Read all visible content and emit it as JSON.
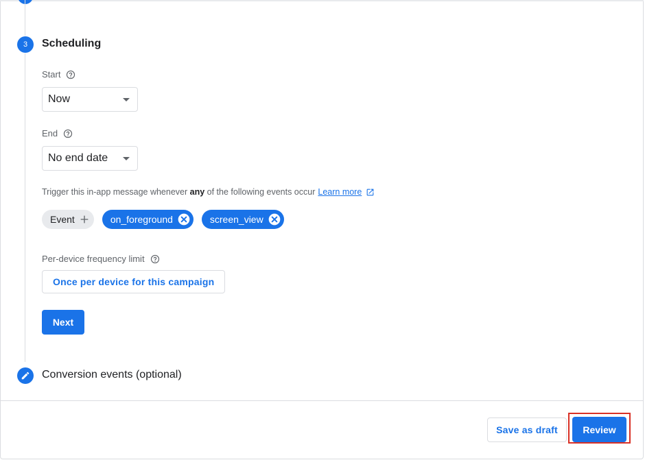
{
  "step3": {
    "number": "3",
    "title": "Scheduling"
  },
  "start": {
    "label": "Start",
    "value": "Now"
  },
  "end": {
    "label": "End",
    "value": "No end date"
  },
  "trigger": {
    "text_before": "Trigger this in-app message whenever ",
    "text_bold": "any",
    "text_after": " of the following events occur",
    "link": "Learn more"
  },
  "events": {
    "add_label": "Event",
    "chips": [
      "on_foreground",
      "screen_view"
    ]
  },
  "frequency": {
    "label": "Per-device frequency limit",
    "value": "Once per device for this campaign"
  },
  "next_label": "Next",
  "step4": {
    "title": "Conversion events (optional)"
  },
  "footer": {
    "draft_label": "Save as draft",
    "review_label": "Review"
  },
  "colors": {
    "primary": "#1a73e8",
    "highlight": "#d93025",
    "chip_grey": "#e8eaed"
  },
  "icons": [
    "help-icon",
    "chevron-down-icon",
    "external-link-icon",
    "plus-icon",
    "close-icon",
    "pencil-icon"
  ]
}
